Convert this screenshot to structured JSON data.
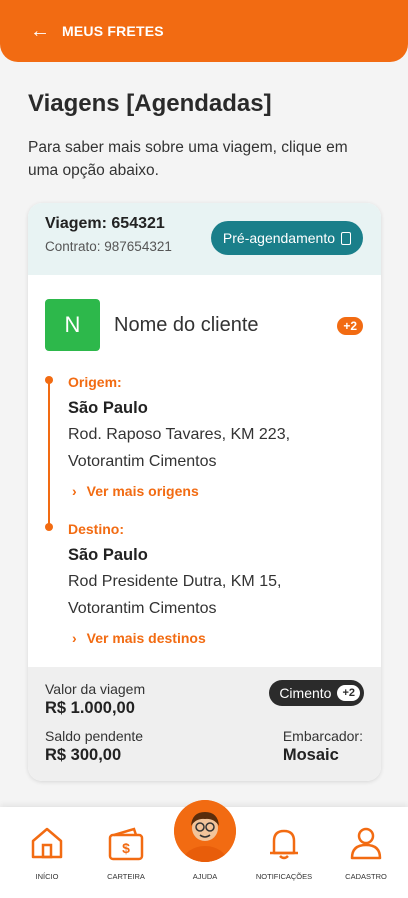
{
  "header": {
    "title": "MEUS FRETES"
  },
  "page": {
    "title": "Viagens [Agendadas]",
    "subtitle": "Para saber mais sobre uma viagem, clique em uma opção abaixo."
  },
  "trip": {
    "trip_label": "Viagem: 654321",
    "contract_label": "Contrato: 987654321",
    "status": "Pré-agendamento",
    "client_initial": "N",
    "client_name": "Nome do cliente",
    "client_extra": "+2",
    "origin": {
      "label": "Origem:",
      "city": "São Paulo",
      "address_line1": "Rod. Raposo Tavares, KM 223,",
      "address_line2": "Votorantim Cimentos",
      "more": "Ver mais origens"
    },
    "destination": {
      "label": "Destino:",
      "city": "São Paulo",
      "address_line1": "Rod Presidente Dutra, KM 15,",
      "address_line2": "Votorantim Cimentos",
      "more": "Ver mais destinos"
    },
    "value_label": "Valor da viagem",
    "value": "R$ 1.000,00",
    "balance_label": "Saldo pendente",
    "balance": "R$ 300,00",
    "cargo": "Cimento",
    "cargo_extra": "+2",
    "shipper_label": "Embarcador:",
    "shipper": "Mosaic"
  },
  "nav": {
    "home": "INÍCIO",
    "wallet": "CARTEIRA",
    "help": "AJUDA",
    "notifications": "NOTIFICAÇÕES",
    "profile": "CADASTRO"
  },
  "colors": {
    "brand": "#f26b12",
    "status": "#1a7f8a",
    "client": "#2db84b"
  }
}
